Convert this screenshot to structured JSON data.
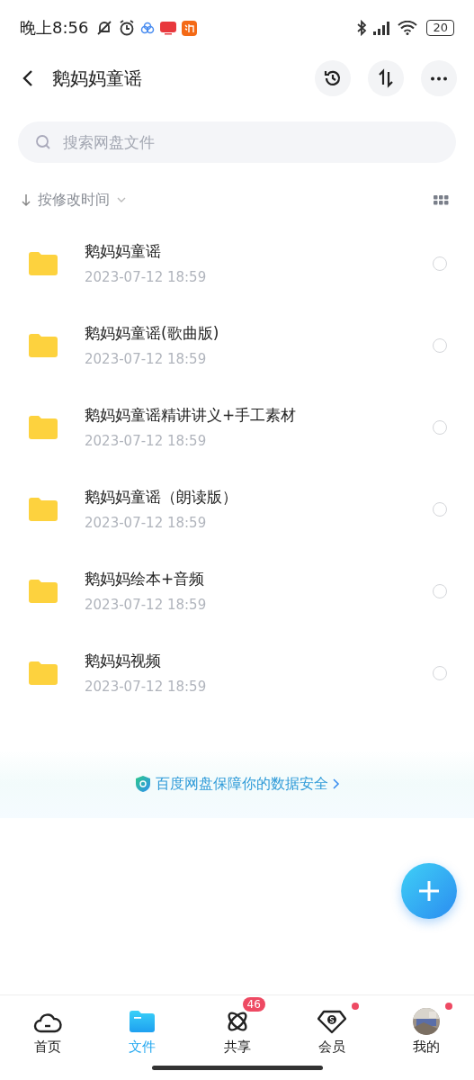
{
  "status_bar": {
    "time": "晚上8:56",
    "battery": "20"
  },
  "header": {
    "title": "鹅妈妈童谣"
  },
  "search": {
    "placeholder": "搜索网盘文件"
  },
  "sort": {
    "label": "按修改时间"
  },
  "files": [
    {
      "name": "鹅妈妈童谣",
      "date": "2023-07-12  18:59",
      "selected": false
    },
    {
      "name": "鹅妈妈童谣(歌曲版)",
      "date": "2023-07-12  18:59",
      "selected": false
    },
    {
      "name": "鹅妈妈童谣精讲讲义+手工素材",
      "date": "2023-07-12  18:59",
      "selected": false
    },
    {
      "name": "鹅妈妈童谣（朗读版）",
      "date": "2023-07-12  18:59",
      "selected": false
    },
    {
      "name": "鹅妈妈绘本+音频",
      "date": "2023-07-12  18:59",
      "selected": false
    },
    {
      "name": "鹅妈妈视频",
      "date": "2023-07-12  18:59",
      "selected": false
    }
  ],
  "notice": {
    "text": "百度网盘保障你的数据安全"
  },
  "tab_bar": [
    {
      "kind": "home",
      "label": "首页",
      "selected": false,
      "dot": false
    },
    {
      "kind": "files",
      "label": "文件",
      "selected": true,
      "dot": false
    },
    {
      "kind": "share",
      "label": "共享",
      "selected": false,
      "badge": "46",
      "dot": false
    },
    {
      "kind": "vip",
      "label": "会员",
      "selected": false,
      "dot": true
    },
    {
      "kind": "me",
      "label": "我的",
      "selected": false,
      "dot": true
    }
  ]
}
